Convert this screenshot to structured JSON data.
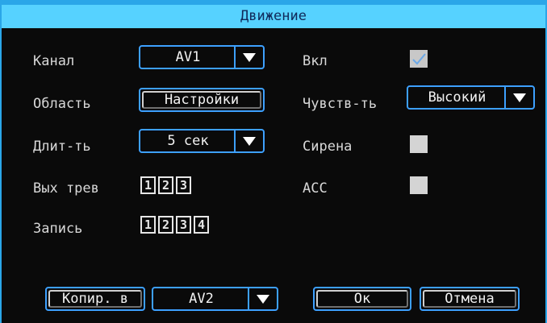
{
  "title": "Движение",
  "channel": {
    "label": "Канал",
    "value": "AV1"
  },
  "enabled": {
    "label": "Вкл",
    "checked": true
  },
  "area": {
    "label": "Область",
    "button": "Настройки"
  },
  "sensitivity": {
    "label": "Чувств-ть",
    "value": "Высокий"
  },
  "duration": {
    "label": "Длит-ть",
    "value": "5 сек"
  },
  "siren": {
    "label": "Сирена",
    "checked": false
  },
  "alarm_out": {
    "label": "Вых трев",
    "items": [
      "1",
      "2",
      "3"
    ]
  },
  "acc": {
    "label": "ACC",
    "checked": false
  },
  "record": {
    "label": "Запись",
    "items": [
      "1",
      "2",
      "3",
      "4"
    ]
  },
  "footer": {
    "copy_label": "Копир. в",
    "copy_target": "AV2",
    "ok_label": "Ок",
    "cancel_label": "Отмена"
  },
  "colors": {
    "title_bg": "#56d2ff",
    "accent_border": "#3da0ff",
    "background": "#0a0a0a"
  }
}
